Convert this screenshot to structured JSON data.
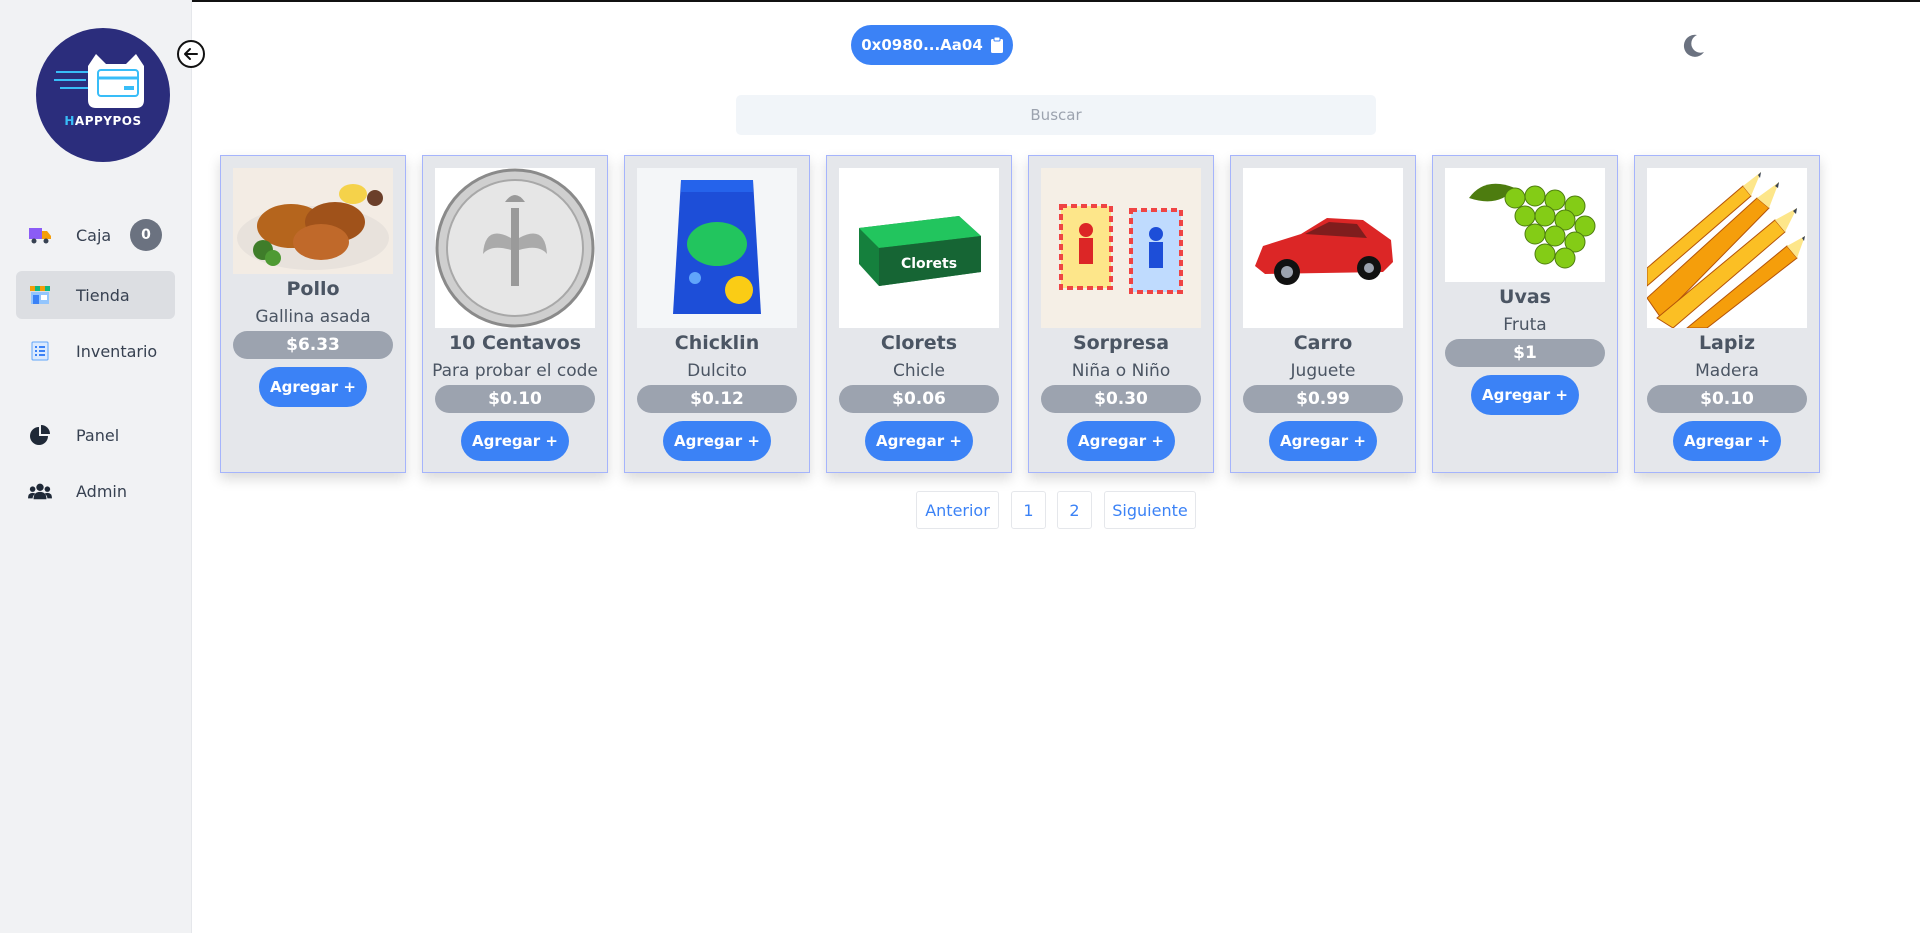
{
  "app": {
    "logo_prefix": "H",
    "logo_rest": "APPYPOS"
  },
  "sidebar": {
    "items": [
      {
        "label": "Caja",
        "icon": "truck-icon",
        "badge": "0"
      },
      {
        "label": "Tienda",
        "icon": "store-icon",
        "active": true
      },
      {
        "label": "Inventario",
        "icon": "list-icon"
      },
      {
        "label": "Panel",
        "icon": "pie-chart-icon"
      },
      {
        "label": "Admin",
        "icon": "users-icon"
      }
    ]
  },
  "header": {
    "wallet": "0x0980...Aa04",
    "wallet_icon": "clipboard-icon",
    "theme_icon": "moon-icon"
  },
  "search": {
    "placeholder": "Buscar",
    "value": ""
  },
  "products": [
    {
      "name": "Pollo",
      "desc": "Gallina asada",
      "price": "$6.33",
      "button": "Agregar +",
      "image": "roast-chicken"
    },
    {
      "name": "10 Centavos",
      "desc": "Para probar el code",
      "price": "$0.10",
      "button": "Agregar +",
      "image": "dime-coin"
    },
    {
      "name": "Chicklin",
      "desc": "Dulcito",
      "price": "$0.12",
      "button": "Agregar +",
      "image": "candy-bag"
    },
    {
      "name": "Clorets",
      "desc": "Chicle",
      "price": "$0.06",
      "button": "Agregar +",
      "image": "gum-box",
      "image_text": "Clorets"
    },
    {
      "name": "Sorpresa",
      "desc": "Niña o Niño",
      "price": "$0.30",
      "button": "Agregar +",
      "image": "surprise-packets"
    },
    {
      "name": "Carro",
      "desc": "Juguete",
      "price": "$0.99",
      "button": "Agregar +",
      "image": "red-car"
    },
    {
      "name": "Uvas",
      "desc": "Fruta",
      "price": "$1",
      "button": "Agregar +",
      "image": "grapes"
    },
    {
      "name": "Lapiz",
      "desc": "Madera",
      "price": "$0.10",
      "button": "Agregar +",
      "image": "pencils"
    }
  ],
  "pagination": {
    "prev": "Anterior",
    "pages": [
      "1",
      "2"
    ],
    "next": "Siguiente"
  },
  "colors": {
    "primary": "#3b82f6",
    "sidebar_bg": "#f1f2f4",
    "card_bg": "#e5e7eb",
    "price_bg": "#9ca3af",
    "logo_bg": "#2b2d7c"
  }
}
